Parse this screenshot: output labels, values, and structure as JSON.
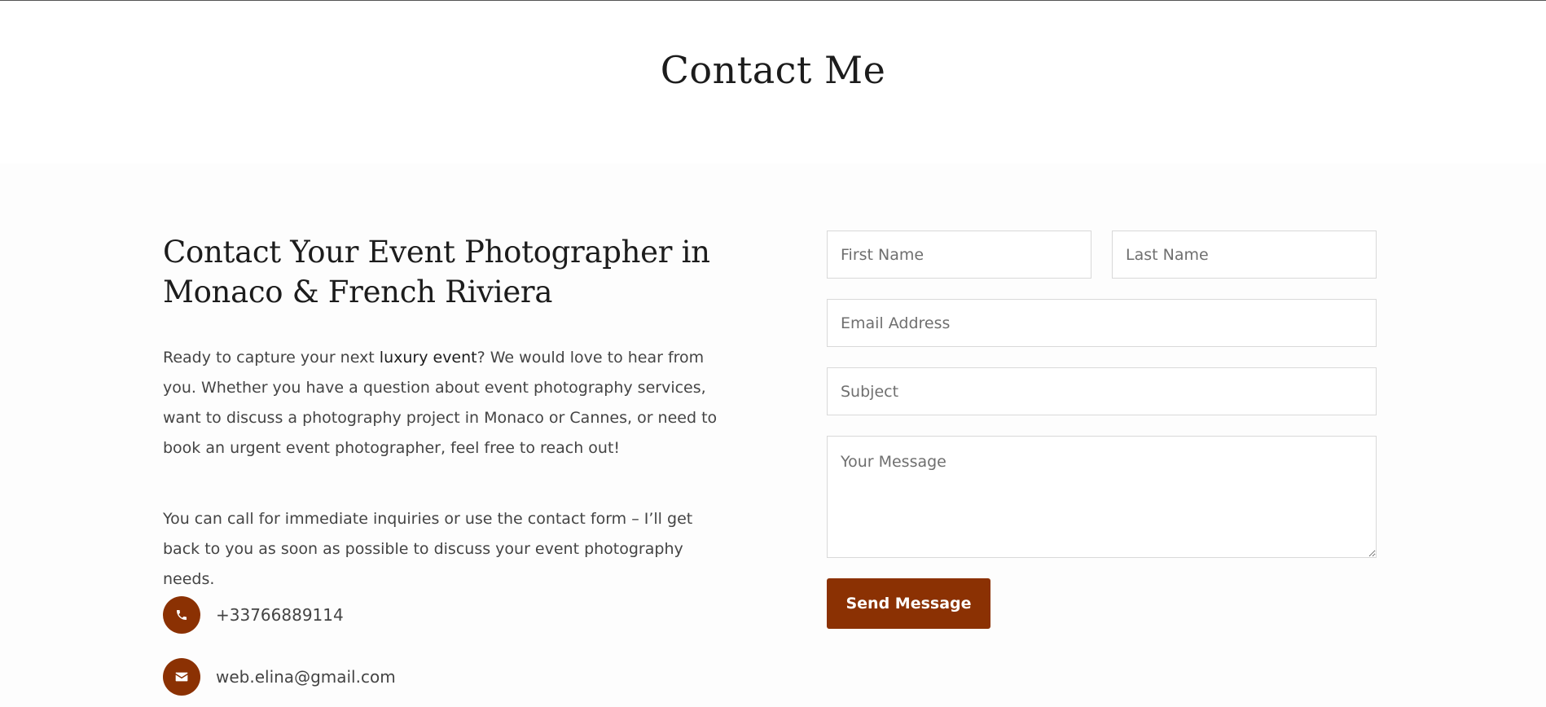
{
  "page": {
    "title": "Contact Me"
  },
  "intro": {
    "heading": "Contact Your Event Photographer in Monaco & French Riviera",
    "paragraph1_before": "Ready to capture your next ",
    "paragraph1_link": "luxury event",
    "paragraph1_after": "? We would love to hear from you. Whether you have a question about event photography services, want to discuss a photography project in Monaco or Cannes, or need to book an urgent event photographer, feel free to reach out!",
    "paragraph2": "You can call for immediate inquiries or use the contact form – I’ll get back to you as soon as possible to discuss your event photography needs."
  },
  "contact": {
    "phone": "+33766889114",
    "phone_icon": "phone-icon",
    "email": "web.elina@gmail.com",
    "email_icon": "envelope-icon"
  },
  "form": {
    "first_name_placeholder": "First Name",
    "last_name_placeholder": "Last Name",
    "email_placeholder": "Email Address",
    "subject_placeholder": "Subject",
    "message_placeholder": "Your Message",
    "submit_label": "Send Message"
  },
  "colors": {
    "accent": "#8b3103",
    "heading": "#1c1c1c",
    "body_text": "#444444",
    "input_border": "#d9d9d9"
  }
}
